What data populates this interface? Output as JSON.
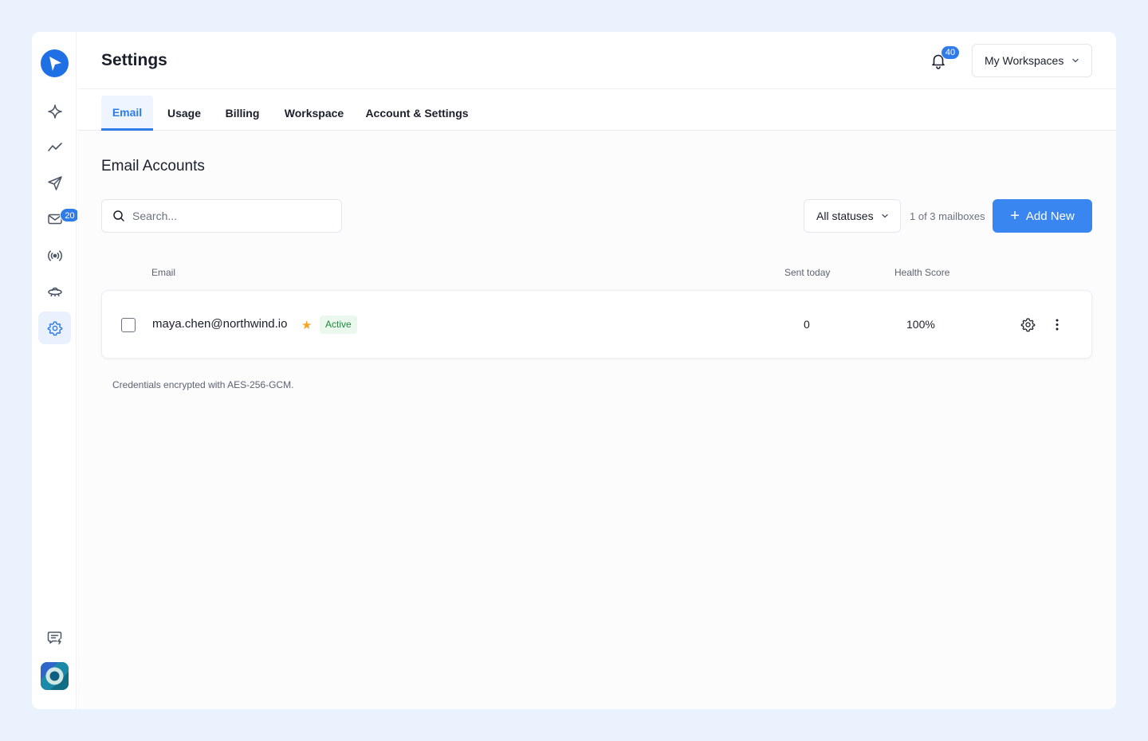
{
  "sidebar": {
    "inbox_badge": "20",
    "items": [
      {
        "name": "sparkle-icon"
      },
      {
        "name": "trend-icon"
      },
      {
        "name": "send-icon"
      },
      {
        "name": "inbox-icon"
      },
      {
        "name": "broadcast-icon"
      },
      {
        "name": "ufo-icon"
      },
      {
        "name": "gear-icon",
        "active": true
      }
    ]
  },
  "header": {
    "title": "Settings",
    "notification_count": "40",
    "workspace_label": "My Workspaces"
  },
  "tabs": [
    {
      "label": "Email",
      "active": true
    },
    {
      "label": "Usage"
    },
    {
      "label": "Billing"
    },
    {
      "label": "Workspace"
    },
    {
      "label": "Account & Settings"
    }
  ],
  "email_accounts": {
    "title": "Email Accounts",
    "search_placeholder": "Search...",
    "status_filter": "All statuses",
    "mailbox_count": "1 of 3 mailboxes",
    "add_button": "Add New",
    "columns": {
      "email": "Email",
      "sent_today": "Sent today",
      "health_score": "Health Score"
    },
    "rows": [
      {
        "email": "maya.chen@northwind.io",
        "status": "Active",
        "sent_today": "0",
        "health_score": "100%"
      }
    ],
    "footnote": "Credentials encrypted with AES-256-GCM."
  },
  "colors": {
    "accent": "#2f7be8",
    "button": "#3a86f0",
    "background": "#eaf2fd",
    "active_badge_bg": "#eaf8ee",
    "active_badge_text": "#1e8a3b",
    "star": "#f5a524"
  }
}
